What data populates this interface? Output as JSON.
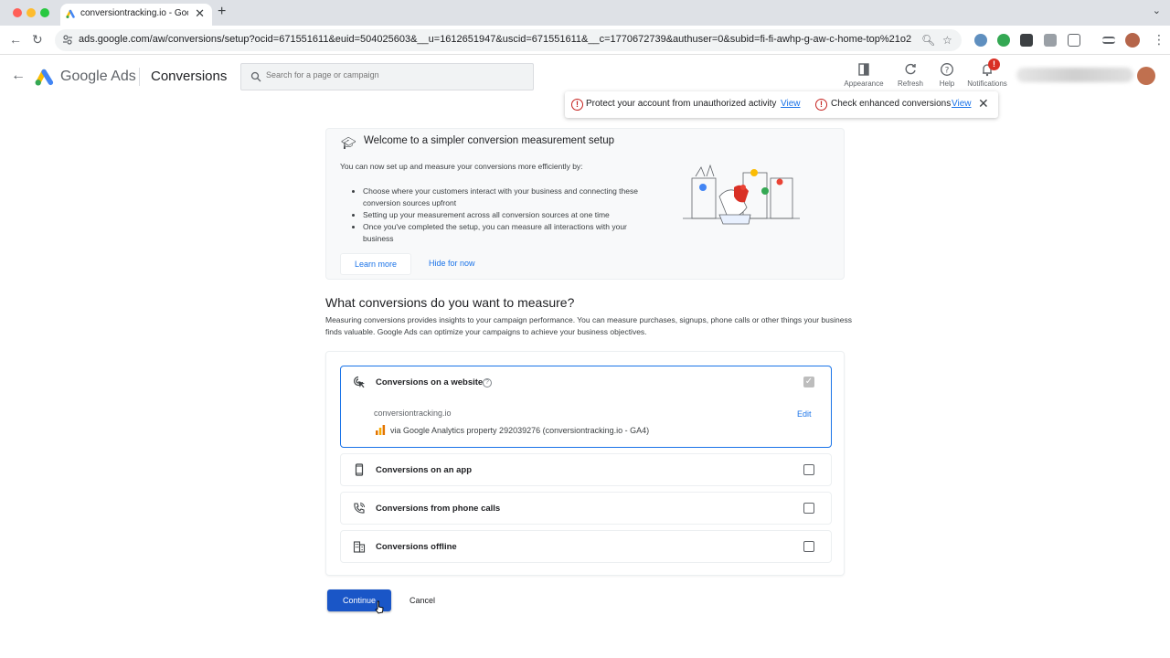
{
  "browser": {
    "tab_title": "conversiontracking.io - Googl",
    "url": "ads.google.com/aw/conversions/setup?ocid=671551611&euid=504025603&__u=1612651947&uscid=671551611&__c=1770672739&authuser=0&subid=fi-fi-awhp-g-aw-c-home-top%21o2",
    "new_tab": "+",
    "close_tab": "✕"
  },
  "header": {
    "brand": "Google Ads",
    "page_title": "Conversions",
    "search_placeholder": "Search for a page or campaign",
    "buttons": [
      {
        "label": "Appearance"
      },
      {
        "label": "Refresh"
      },
      {
        "label": "Help"
      },
      {
        "label": "Notifications"
      }
    ],
    "notification_count": "!"
  },
  "alerts": {
    "items": [
      {
        "text": "Protect your account from unauthorized activity",
        "link": "View"
      },
      {
        "text": "Check enhanced conversions",
        "link": "View"
      }
    ]
  },
  "welcome": {
    "title": "Welcome to a simpler conversion measurement setup",
    "description": "You can now set up and measure your conversions more efficiently by:",
    "bullets": [
      "Choose where your customers interact with your business and connecting these conversion sources upfront",
      "Setting up your measurement across all conversion sources at one time",
      "Once you've completed the setup, you can measure all interactions with your business"
    ],
    "learn_more": "Learn more",
    "hide": "Hide for now"
  },
  "question": {
    "title": "What conversions do you want to measure?",
    "description": "Measuring conversions provides insights to your campaign performance. You can measure purchases, signups, phone calls or other things your business finds valuable. Google Ads can optimize your campaigns to achieve your business objectives."
  },
  "options": {
    "website": {
      "label": "Conversions on a website",
      "checked": true,
      "domain": "conversiontracking.io",
      "source": "via Google Analytics property 292039276 (conversiontracking.io - GA4)",
      "edit": "Edit"
    },
    "rows": [
      {
        "label": "Conversions on an app",
        "checked": false
      },
      {
        "label": "Conversions from phone calls",
        "checked": false
      },
      {
        "label": "Conversions offline",
        "checked": false
      }
    ]
  },
  "actions": {
    "continue": "Continue",
    "cancel": "Cancel"
  },
  "colors": {
    "accent": "#1a73e8",
    "primary_button": "#1a56c7",
    "alert": "#c5221f"
  }
}
